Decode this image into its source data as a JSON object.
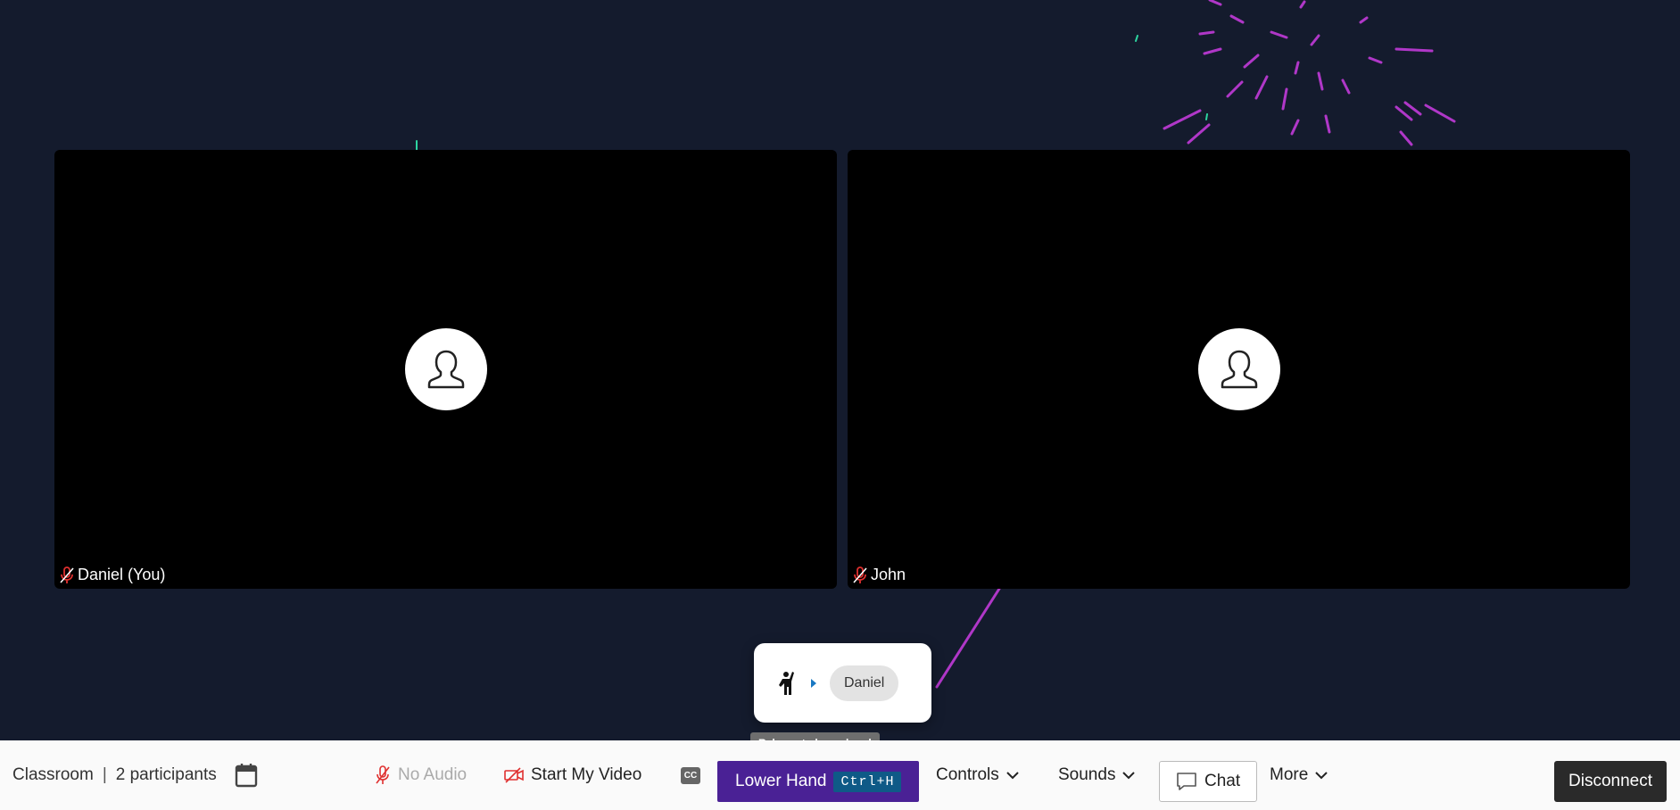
{
  "participants": [
    {
      "name": "Daniel (You)"
    },
    {
      "name": "John"
    }
  ],
  "hand_popup": {
    "raised_by": "Daniel",
    "tooltip": "Release to lower hand"
  },
  "toolbar": {
    "room_name": "Classroom",
    "separator": "|",
    "participant_count": "2 participants",
    "audio_label": "No Audio",
    "video_label": "Start My Video",
    "cc_label": "CC",
    "lower_hand_label": "Lower Hand",
    "lower_hand_shortcut": "Ctrl+H",
    "controls_label": "Controls",
    "sounds_label": "Sounds",
    "chat_label": "Chat",
    "more_label": "More",
    "disconnect_label": "Disconnect"
  },
  "colors": {
    "background": "#141b2d",
    "lower_hand_button": "#4a2195",
    "shortcut_badge": "#0f5a87",
    "muted_mic": "#e0302f",
    "firework": "#c13bd9"
  }
}
